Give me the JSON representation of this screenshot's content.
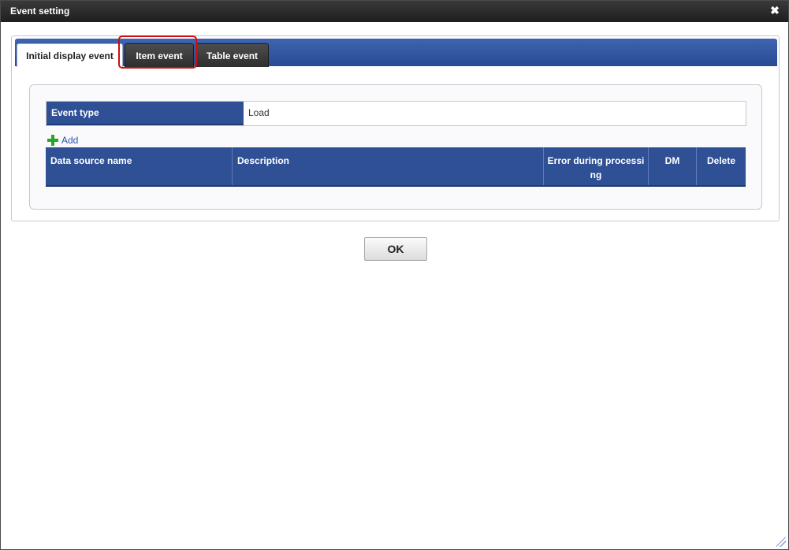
{
  "dialog": {
    "title": "Event setting",
    "close_icon": "close-icon"
  },
  "tabs": [
    {
      "label": "Initial display event",
      "active": true
    },
    {
      "label": "Item event",
      "active": false
    },
    {
      "label": "Table event",
      "active": false
    }
  ],
  "event_type": {
    "label": "Event type",
    "value": "Load"
  },
  "add_link": {
    "label": "Add",
    "icon": "add-icon"
  },
  "table": {
    "columns": [
      "Data source name",
      "Description",
      "Error during processi\nng",
      "DM",
      "Delete"
    ]
  },
  "ok_button": {
    "label": "OK"
  },
  "colors": {
    "header_blue": "#2f5094",
    "tabbar_blue": "#3f65b0",
    "dark_tab": "#3a3a3a",
    "highlight_red": "#d10d0d",
    "add_green": "#2aa32a"
  }
}
